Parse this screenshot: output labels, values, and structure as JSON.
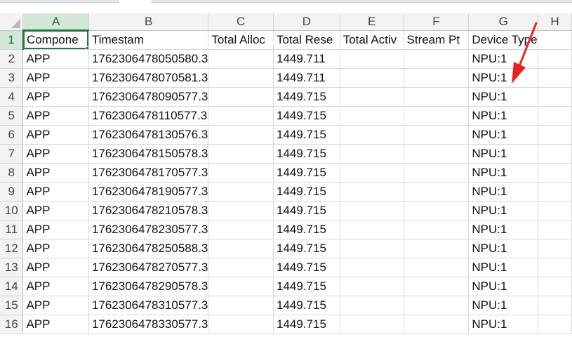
{
  "columns": [
    "A",
    "B",
    "C",
    "D",
    "E",
    "F",
    "G",
    "H"
  ],
  "selected_column": "A",
  "header_row": {
    "row_number": "1",
    "cells": [
      "Compone",
      "Timestam",
      "Total Alloc",
      "Total Rese",
      "Total Activ",
      "Stream Pt",
      "Device Type",
      ""
    ]
  },
  "rows": [
    {
      "n": "2",
      "A": "APP",
      "B": "1762306478050580.3",
      "D": "1449.711",
      "G": "NPU:1"
    },
    {
      "n": "3",
      "A": "APP",
      "B": "1762306478070581.3",
      "D": "1449.711",
      "G": "NPU:1"
    },
    {
      "n": "4",
      "A": "APP",
      "B": "1762306478090577.3",
      "D": "1449.715",
      "G": "NPU:1"
    },
    {
      "n": "5",
      "A": "APP",
      "B": "1762306478110577.3",
      "D": "1449.715",
      "G": "NPU:1"
    },
    {
      "n": "6",
      "A": "APP",
      "B": "1762306478130576.3",
      "D": "1449.715",
      "G": "NPU:1"
    },
    {
      "n": "7",
      "A": "APP",
      "B": "1762306478150578.3",
      "D": "1449.715",
      "G": "NPU:1"
    },
    {
      "n": "8",
      "A": "APP",
      "B": "1762306478170577.3",
      "D": "1449.715",
      "G": "NPU:1"
    },
    {
      "n": "9",
      "A": "APP",
      "B": "1762306478190577.3",
      "D": "1449.715",
      "G": "NPU:1"
    },
    {
      "n": "10",
      "A": "APP",
      "B": "1762306478210578.3",
      "D": "1449.715",
      "G": "NPU:1"
    },
    {
      "n": "11",
      "A": "APP",
      "B": "1762306478230577.3",
      "D": "1449.715",
      "G": "NPU:1"
    },
    {
      "n": "12",
      "A": "APP",
      "B": "1762306478250588.3",
      "D": "1449.715",
      "G": "NPU:1"
    },
    {
      "n": "13",
      "A": "APP",
      "B": "1762306478270577.3",
      "D": "1449.715",
      "G": "NPU:1"
    },
    {
      "n": "14",
      "A": "APP",
      "B": "1762306478290578.3",
      "D": "1449.715",
      "G": "NPU:1"
    },
    {
      "n": "15",
      "A": "APP",
      "B": "1762306478310577.3",
      "D": "1449.715",
      "G": "NPU:1"
    },
    {
      "n": "16",
      "A": "APP",
      "B": "1762306478330577.3",
      "D": "1449.715",
      "G": "NPU:1"
    }
  ],
  "colors": {
    "selection_green": "#217346",
    "annotation_arrow": "#e8231f"
  },
  "annotation": {
    "icon": "red-arrow-icon"
  }
}
